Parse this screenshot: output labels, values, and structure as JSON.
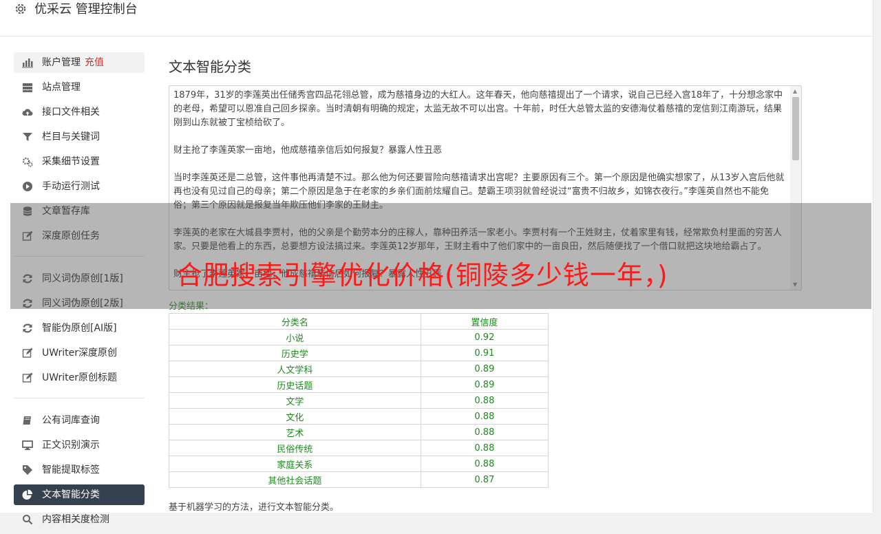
{
  "header": {
    "title": "优采云 管理控制台",
    "icon": "gear-icon"
  },
  "sidebar": {
    "account": {
      "label": "账户管理",
      "recharge": "充值"
    },
    "items1": [
      {
        "label": "站点管理",
        "icon": "server-icon"
      },
      {
        "label": "接口文件相关",
        "icon": "cloud-upload-icon"
      },
      {
        "label": "栏目与关键词",
        "icon": "filter-icon"
      },
      {
        "label": "采集细节设置",
        "icon": "gears-icon"
      },
      {
        "label": "手动运行测试",
        "icon": "play-icon"
      },
      {
        "label": "文章暂存库",
        "icon": "database-icon"
      },
      {
        "label": "深度原创任务",
        "icon": "edit-icon"
      }
    ],
    "items2": [
      {
        "label": "同义词伪原创[1版]",
        "icon": "refresh-icon"
      },
      {
        "label": "同义词伪原创[2版]",
        "icon": "refresh-icon"
      },
      {
        "label": "智能伪原创[AI版]",
        "icon": "refresh-icon"
      },
      {
        "label": "UWriter深度原创",
        "icon": "edit-icon"
      },
      {
        "label": "UWriter原创标题",
        "icon": "edit-icon"
      }
    ],
    "items3": [
      {
        "label": "公有词库查询",
        "icon": "book-icon"
      },
      {
        "label": "正文识别演示",
        "icon": "monitor-icon"
      },
      {
        "label": "智能提取标签",
        "icon": "tag-icon"
      },
      {
        "label": "文本智能分类",
        "icon": "pie-chart-icon"
      },
      {
        "label": "内容相关度检测",
        "icon": "search-icon"
      }
    ]
  },
  "main": {
    "title": "文本智能分类",
    "paragraphs": [
      "1879年，31岁的李莲英出任储秀宫四品花翎总管，成为慈禧身边的大红人。这年春天，他向慈禧提出了一个请求，说自己已经入宫18年了，十分想念家中的老母，希望可以恩准自己回乡探亲。当时清朝有明确的规定，太监无故不可以出宫。十年前，时任大总管太监的安德海仗着慈禧的宠信到江南游玩，结果刚到山东就被丁宝桢给砍了。",
      "财主抢了李莲英家一亩地，他成慈禧亲信后如何报复？暴露人性丑恶",
      "当时李莲英还是二总管，这件事他再清楚不过。那么他为何还要冒险向慈禧请求出宫呢？主要原因有三个。第一个原因是他确实想家了，从13岁入宫后他就再也没有见过自己的母亲；第二个原因是急于在老家的乡亲们面前炫耀自己。楚霸王项羽就曾经说过“富贵不归故乡，如锦衣夜行。”李莲英自然也不能免俗；第三个原因就是报复当年欺压他们李家的王财主。",
      "李莲英的老家在大城县李贾村，他的父亲是个勤劳本分的庄稼人，靠种田养活一家老小。李贾村有一个王姓财主，仗着家里有钱，经常欺负村里面的穷苦人家。只要是他看上的东西，总要想方设法搞过来。李莲英12岁那年，王财主看中了他们家中的一亩良田，然后随便找了一个借口就把这块地给霸占了。",
      "财主抢了李莲英家一亩地，他成慈禧亲信后如何报复？暴露人性丑恶"
    ],
    "result_label": "分类结果：",
    "table": {
      "headers": [
        "分类名",
        "置信度"
      ],
      "rows": [
        [
          "小说",
          "0.92"
        ],
        [
          "历史学",
          "0.91"
        ],
        [
          "人文学科",
          "0.89"
        ],
        [
          "历史话题",
          "0.89"
        ],
        [
          "文学",
          "0.88"
        ],
        [
          "文化",
          "0.88"
        ],
        [
          "艺术",
          "0.88"
        ],
        [
          "民俗传统",
          "0.88"
        ],
        [
          "家庭关系",
          "0.88"
        ],
        [
          "其他社会话题",
          "0.87"
        ]
      ]
    },
    "note": "基于机器学习的方法，进行文本智能分类。"
  },
  "overlay": {
    "text": "合肥搜索引擎优化价格(铜陵多少钱一年，)"
  }
}
